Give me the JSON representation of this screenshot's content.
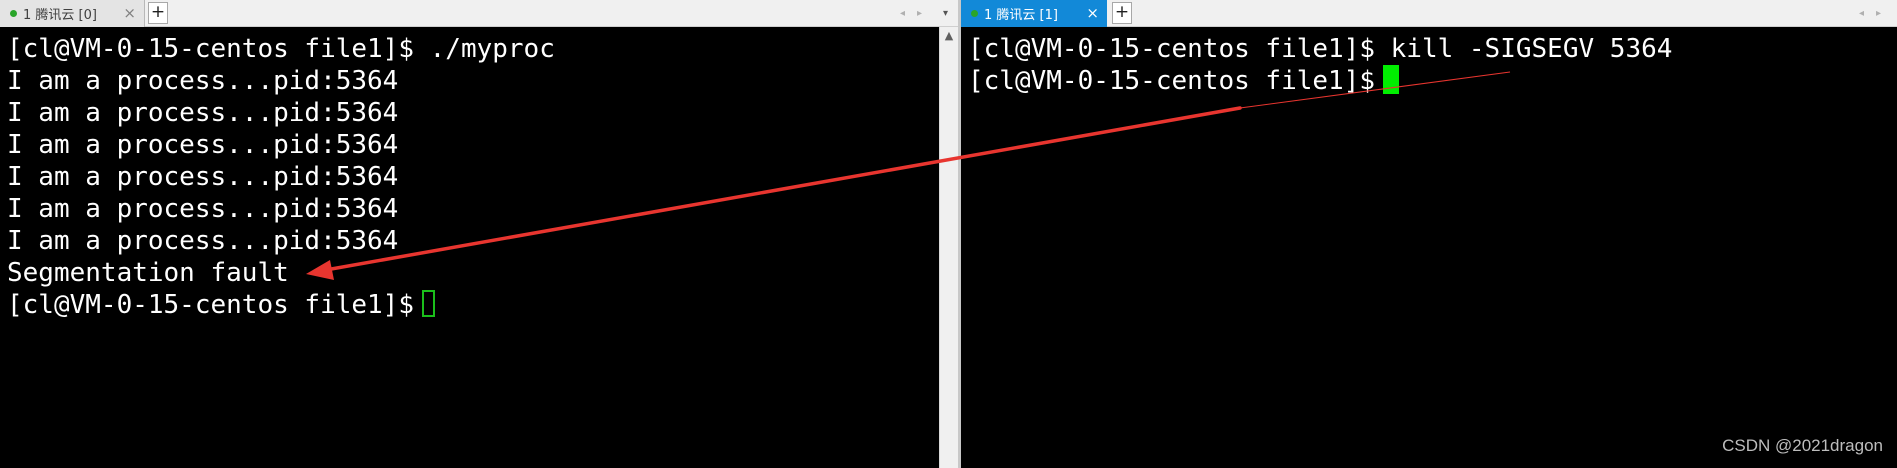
{
  "left_pane": {
    "tab": {
      "label": "1 腾讯云 [0]",
      "close_glyph": "×",
      "status_color": "#2aa52a"
    },
    "add_tab_glyph": "+",
    "nav": {
      "prev": "◂",
      "next": "▸",
      "menu": "▾"
    },
    "lines": [
      "[cl@VM-0-15-centos file1]$ ./myproc",
      "I am a process...pid:5364",
      "I am a process...pid:5364",
      "I am a process...pid:5364",
      "I am a process...pid:5364",
      "I am a process...pid:5364",
      "I am a process...pid:5364",
      "Segmentation fault"
    ],
    "prompt": "[cl@VM-0-15-centos file1]$",
    "scroll_up_glyph": "▲"
  },
  "right_pane": {
    "tab": {
      "label": "1 腾讯云 [1]",
      "close_glyph": "×",
      "status_color": "#2aa52a",
      "active_color": "#1289d8"
    },
    "add_tab_glyph": "+",
    "nav": {
      "prev": "◂",
      "next": "▸"
    },
    "lines": [
      "[cl@VM-0-15-centos file1]$ kill -SIGSEGV 5364"
    ],
    "prompt": "[cl@VM-0-15-centos file1]$"
  },
  "annotation": {
    "arrow_color": "#e8352f"
  },
  "watermark": "CSDN @2021dragon"
}
